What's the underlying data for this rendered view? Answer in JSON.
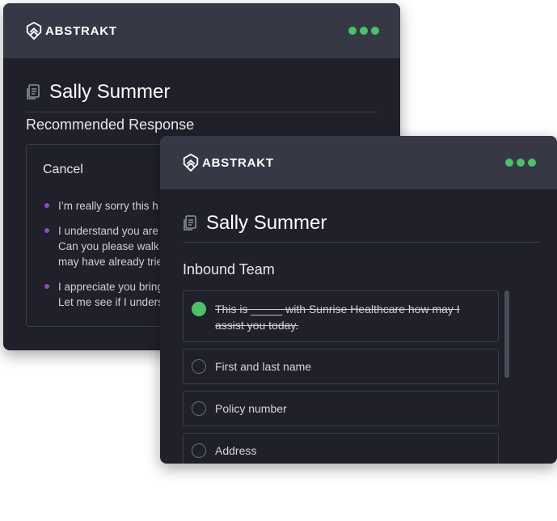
{
  "back_card": {
    "brand": "ABSTRAKT",
    "contact_name": "Sally Summer",
    "section_title": "Recommended Response",
    "response": {
      "title": "Cancel",
      "bullets": [
        "I’m really sorry this h",
        "I understand you are\nCan you please walk\nmay have already trie",
        "I appreciate you bring\nLet me see if I unders"
      ]
    }
  },
  "front_card": {
    "brand": "ABSTRAKT",
    "contact_name": "Sally Summer",
    "section_title": "Inbound  Team",
    "checklist": [
      {
        "label": "This is _____ with Sunrise Healthcare how may I assist you today.",
        "checked": true
      },
      {
        "label": "First and last name",
        "checked": false
      },
      {
        "label": "Policy number",
        "checked": false
      },
      {
        "label": "Address",
        "checked": false
      }
    ]
  },
  "colors": {
    "card_bg": "#1f2029",
    "header_bg": "#363845",
    "status_green": "#4ec06a",
    "bullet_purple": "#8a4dc9"
  },
  "icons": [
    "abstrakt-logo-icon",
    "more-dots-icon",
    "document-icon",
    "radio-checked-icon",
    "radio-unchecked-icon"
  ]
}
